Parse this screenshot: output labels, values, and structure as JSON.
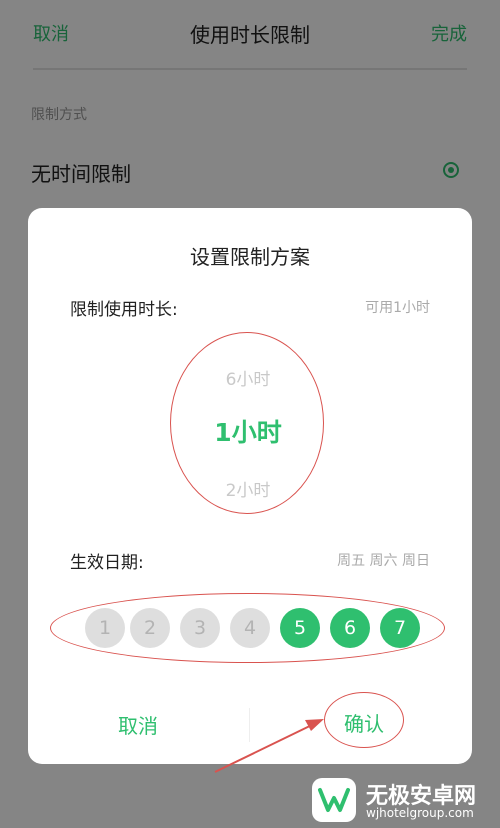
{
  "topbar": {
    "cancel": "取消",
    "title": "使用时长限制",
    "done": "完成"
  },
  "settings": {
    "section_label": "限制方式",
    "option_label": "无时间限制"
  },
  "dialog": {
    "title": "设置限制方案",
    "duration_label": "限制使用时长:",
    "duration_hint": "可用1小时",
    "picker": {
      "prev": "6小时",
      "selected": "1小时",
      "next": "2小时"
    },
    "date_label": "生效日期:",
    "date_hint": "周五 周六 周日",
    "days": [
      {
        "label": "1",
        "selected": false
      },
      {
        "label": "2",
        "selected": false
      },
      {
        "label": "3",
        "selected": false
      },
      {
        "label": "4",
        "selected": false
      },
      {
        "label": "5",
        "selected": true
      },
      {
        "label": "6",
        "selected": true
      },
      {
        "label": "7",
        "selected": true
      }
    ],
    "cancel": "取消",
    "confirm": "确认"
  },
  "colors": {
    "accent": "#2fbf6f",
    "annotation": "#d9534f"
  },
  "watermark": {
    "name": "无极安卓网",
    "url": "wjhotelgroup.com"
  }
}
